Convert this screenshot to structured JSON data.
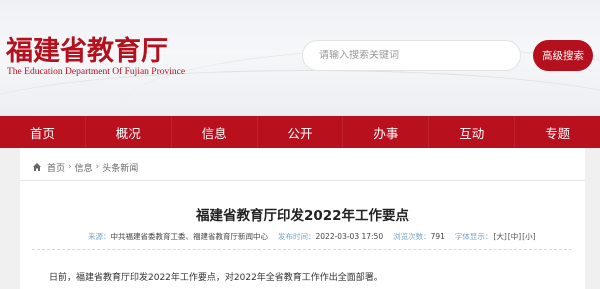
{
  "header": {
    "title": "福建省教育厅",
    "subtitle": "The Education Department Of Fujian Province",
    "search_placeholder": "请输入搜索关键词",
    "advanced_search_label": "高级搜索"
  },
  "nav": {
    "items": [
      {
        "label": "首页"
      },
      {
        "label": "概况"
      },
      {
        "label": "信息"
      },
      {
        "label": "公开"
      },
      {
        "label": "办事"
      },
      {
        "label": "互动"
      },
      {
        "label": "专题"
      }
    ]
  },
  "breadcrumb": {
    "items": [
      "首页",
      "信息",
      "头条新闻"
    ],
    "separator": "›"
  },
  "article": {
    "title": "福建省教育厅印发2022年工作要点",
    "source_label": "来源：",
    "source_value": "中共福建省委教育工委、福建省教育厅新闻中心",
    "time_label": "发布时间：",
    "time_value": "2022-03-03 17:50",
    "views_label": "浏览次数：",
    "views_value": "791",
    "font_size_label": "字体显示：",
    "font_sizes": [
      "[大]",
      "[中]",
      "[小]"
    ],
    "first_paragraph": "日前，福建省教育厅印发2022年工作要点，对2022年全省教育工作作出全面部署。"
  },
  "colors": {
    "brand_red": "#b8111d",
    "meta_label_blue": "#7da7c9"
  },
  "icons": {
    "breadcrumb_home": "home-icon"
  }
}
